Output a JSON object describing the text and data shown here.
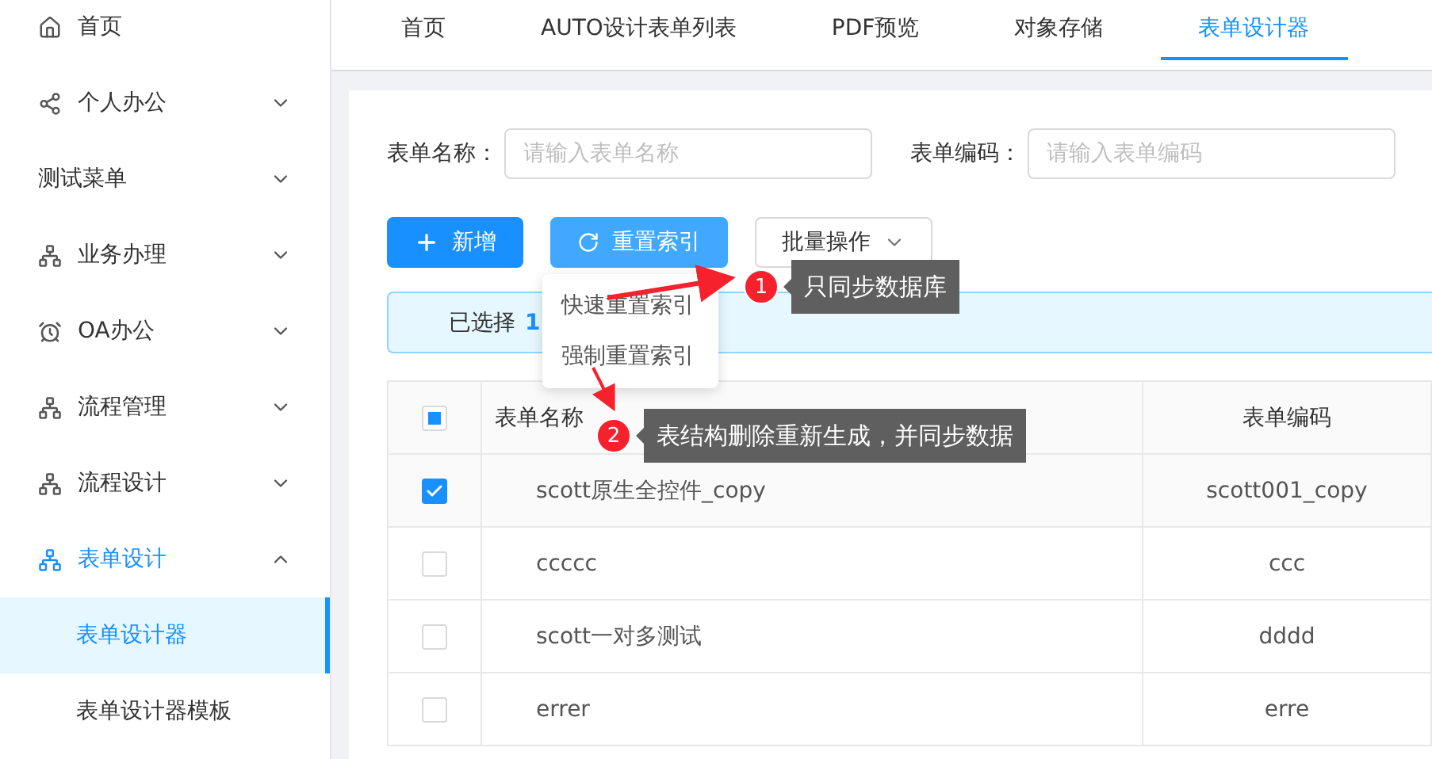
{
  "sidebar": {
    "items": [
      {
        "label": "首页",
        "kind": "link"
      },
      {
        "label": "个人办公",
        "kind": "menu",
        "expanded": false
      },
      {
        "label": "测试菜单",
        "kind": "menu",
        "expanded": false
      },
      {
        "label": "业务办理",
        "kind": "menu",
        "expanded": false
      },
      {
        "label": "OA办公",
        "kind": "menu",
        "expanded": false
      },
      {
        "label": "流程管理",
        "kind": "menu",
        "expanded": false
      },
      {
        "label": "流程设计",
        "kind": "menu",
        "expanded": false
      },
      {
        "label": "表单设计",
        "kind": "menu",
        "expanded": true,
        "children": [
          {
            "label": "表单设计器",
            "selected": true
          },
          {
            "label": "表单设计器模板",
            "selected": false
          }
        ]
      }
    ]
  },
  "tabs": [
    {
      "label": "首页",
      "selected": false
    },
    {
      "label": "AUTO设计表单列表",
      "selected": false
    },
    {
      "label": "PDF预览",
      "selected": false
    },
    {
      "label": "对象存储",
      "selected": false
    },
    {
      "label": "表单设计器",
      "selected": true
    }
  ],
  "search": [
    {
      "label": "表单名称：",
      "placeholder": "请输入表单名称"
    },
    {
      "label": "表单编码：",
      "placeholder": "请输入表单编码"
    }
  ],
  "toolbar": {
    "add_button": "新增",
    "reset_button": "重置索引",
    "batch_button": "批量操作"
  },
  "dropdown": {
    "items": [
      "快速重置索引",
      "强制重置索引"
    ]
  },
  "alert": {
    "prefix": "已选择",
    "count": "1"
  },
  "table": {
    "select_all": {
      "checked": false,
      "indeterminate": true
    },
    "columns": [
      "表单名称",
      "表单编码"
    ],
    "rows": [
      {
        "name": "scott原生全控件_copy",
        "code": "scott001_copy",
        "selected": true
      },
      {
        "name": "ccccc",
        "code": "ccc",
        "selected": false
      },
      {
        "name": "scott一对多测试",
        "code": "dddd",
        "selected": false
      },
      {
        "name": "errer",
        "code": "erre",
        "selected": false
      }
    ]
  },
  "annotations": [
    {
      "number": "1",
      "text": "只同步数据库"
    },
    {
      "number": "2",
      "text": "表结构删除重新生成，并同步数据"
    }
  ]
}
